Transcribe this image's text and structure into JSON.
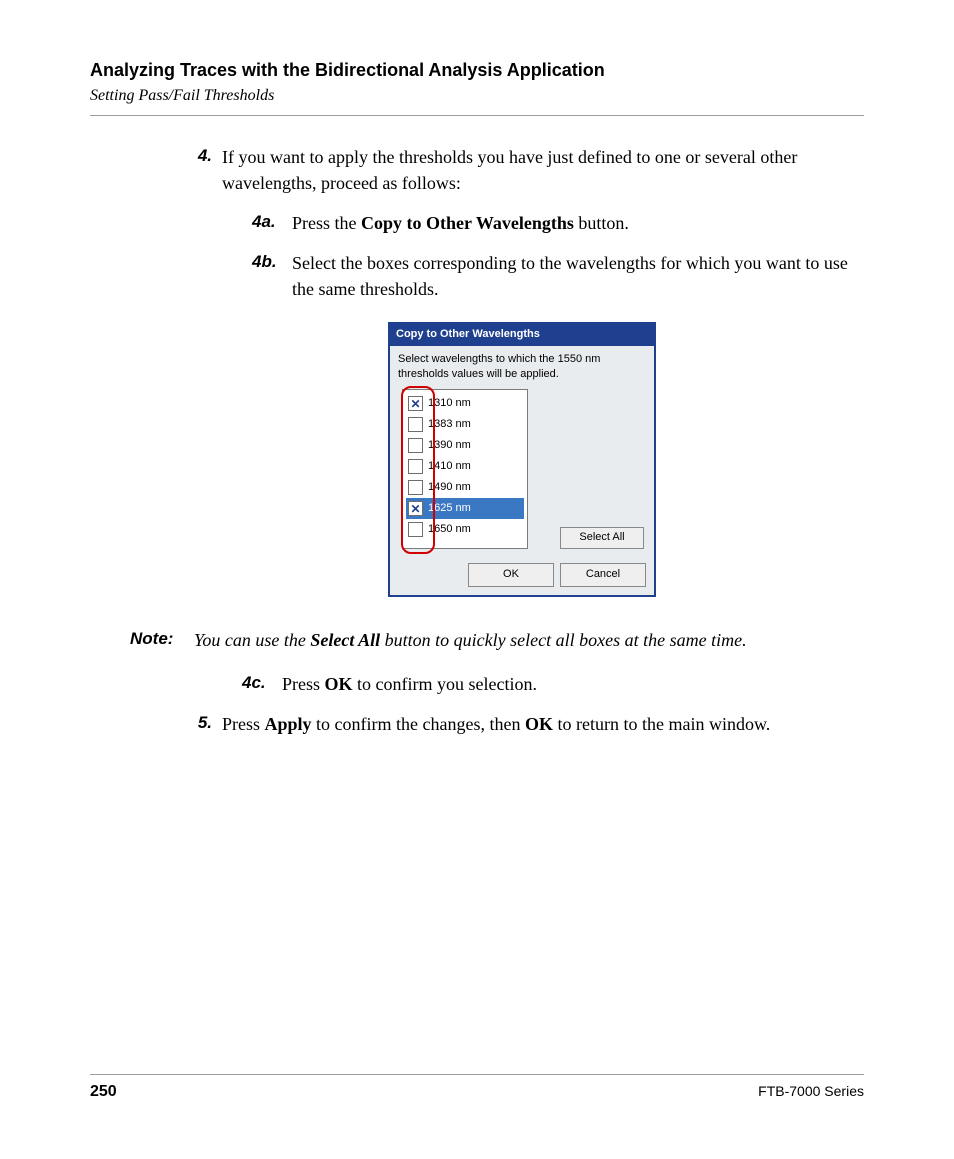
{
  "header": {
    "chapter": "Analyzing Traces with the Bidirectional Analysis Application",
    "section": "Setting Pass/Fail Thresholds"
  },
  "steps": {
    "s4": {
      "num": "4.",
      "text_a": "If you want to apply the thresholds you have just defined to one or several other wavelengths, proceed as follows:"
    },
    "s4a": {
      "num": "4a.",
      "pre": "Press the ",
      "bold": "Copy to Other Wavelengths",
      "post": " button."
    },
    "s4b": {
      "num": "4b.",
      "text": "Select the boxes corresponding to the wavelengths for which you want to use the same thresholds."
    },
    "s4c": {
      "num": "4c.",
      "pre": "Press ",
      "bold": "OK",
      "post": " to confirm you selection."
    },
    "s5": {
      "num": "5.",
      "pre": "Press ",
      "bold1": "Apply",
      "mid": " to confirm the changes, then ",
      "bold2": "OK",
      "post": " to return to the main window."
    }
  },
  "note": {
    "label": "Note:",
    "pre": "You can use the ",
    "bold": "Select All",
    "post": " button to quickly select all boxes at the same time."
  },
  "dialog": {
    "title": "Copy to Other Wavelengths",
    "instruction": "Select wavelengths to which the 1550 nm thresholds values will be applied.",
    "items": [
      {
        "label": "1310 nm",
        "checked": true,
        "selected": false
      },
      {
        "label": "1383 nm",
        "checked": false,
        "selected": false
      },
      {
        "label": "1390 nm",
        "checked": false,
        "selected": false
      },
      {
        "label": "1410 nm",
        "checked": false,
        "selected": false
      },
      {
        "label": "1490 nm",
        "checked": false,
        "selected": false
      },
      {
        "label": "1625 nm",
        "checked": true,
        "selected": true
      },
      {
        "label": "1650 nm",
        "checked": false,
        "selected": false
      }
    ],
    "select_all": "Select All",
    "ok": "OK",
    "cancel": "Cancel"
  },
  "footer": {
    "page": "250",
    "series": "FTB-7000 Series"
  }
}
